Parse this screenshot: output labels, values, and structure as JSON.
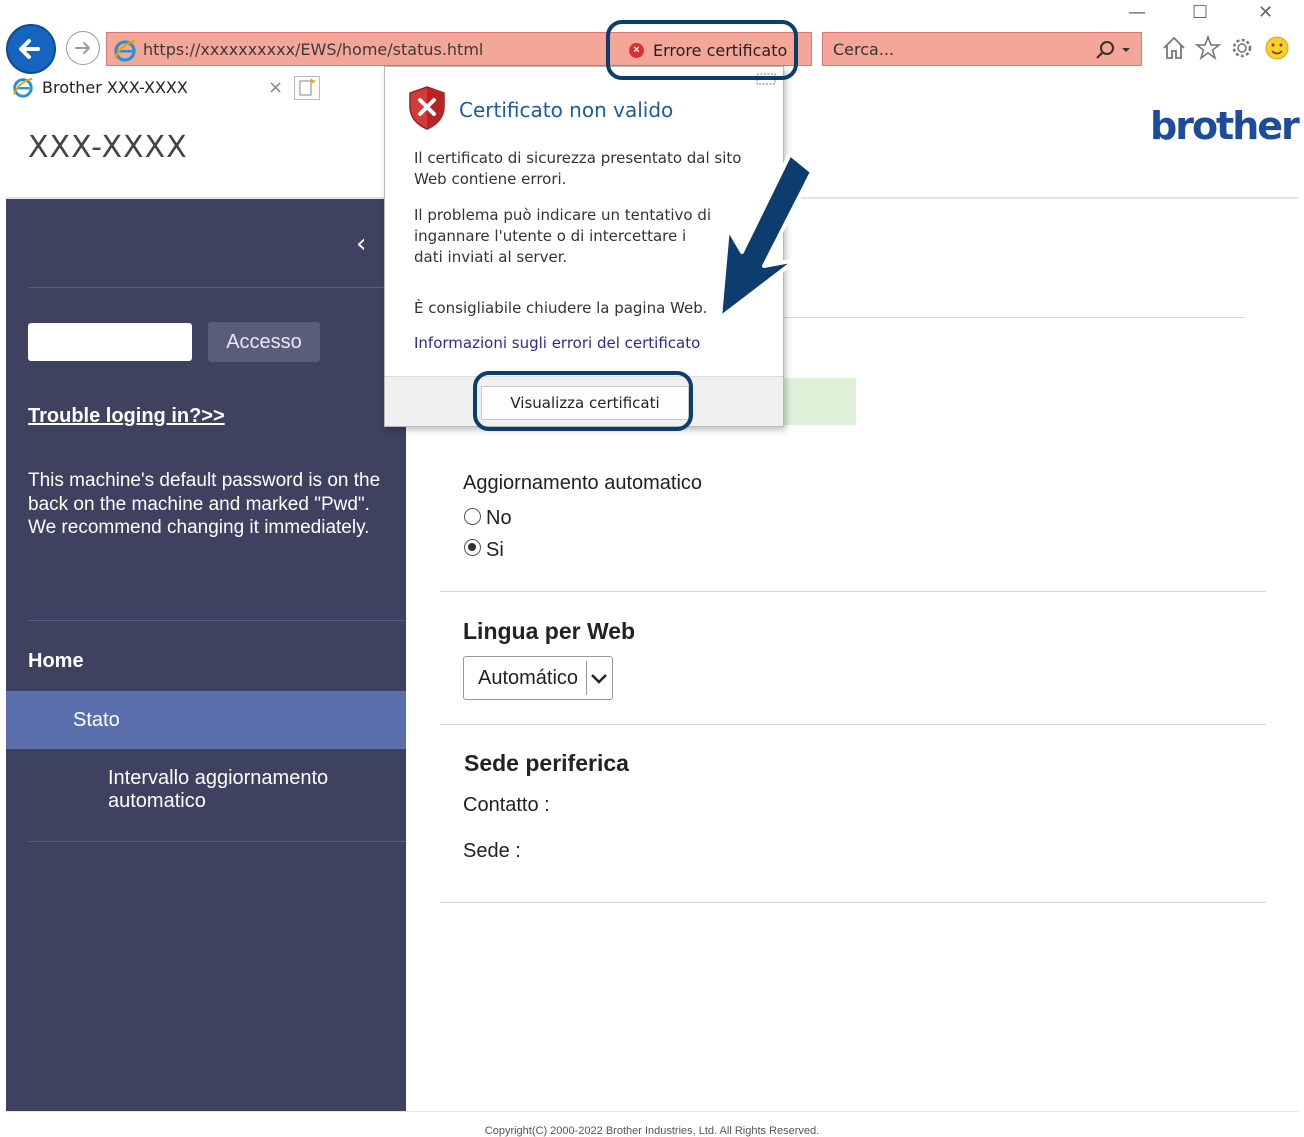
{
  "browser": {
    "address_url": "https://xxxxxxxxxx/EWS/home/status.html",
    "cert_error_label": "Errore certificato",
    "search_placeholder": "Cerca...",
    "tab_title": "Brother XXX-XXXX",
    "window_controls": {
      "minimize": "—",
      "maximize": "☐",
      "close": "✕"
    },
    "highlight_color": "#0c3d6e",
    "address_bar_color": "#f4a799"
  },
  "page": {
    "model": "XXX-XXXX",
    "logo": "brother",
    "sidebar": {
      "collapse_icon": "‹",
      "login_button": "Accesso",
      "trouble_link": "Trouble loging in?>>",
      "password_note": "This machine's default password is on the back on the machine and marked \"Pwd\".\nWe recommend changing it immediately.",
      "nav": {
        "home": "Home",
        "stato": "Stato",
        "interval": "Intervallo aggiornamento automatico"
      }
    },
    "auto_refresh": {
      "title": "Aggiornamento automatico",
      "options": [
        "No",
        "Si"
      ],
      "selected": "Si"
    },
    "language": {
      "title": "Lingua per Web",
      "selected": "Automático"
    },
    "location": {
      "title": "Sede periferica",
      "contact_label": "Contatto :",
      "location_label": "Sede :"
    },
    "copyright": "Copyright(C) 2000-2022 Brother Industries, Ltd. All Rights Reserved."
  },
  "popup": {
    "title": "Certificato non valido",
    "para1": "Il certificato di sicurezza presentato dal sito Web contiene errori.",
    "para2": "Il problema può indicare un tentativo di ingannare l'utente o di intercettare i dati inviati al server.",
    "para3": "È consigliabile chiudere la pagina Web.",
    "link": "Informazioni sugli errori del certificato",
    "button": "Visualizza certificati"
  }
}
